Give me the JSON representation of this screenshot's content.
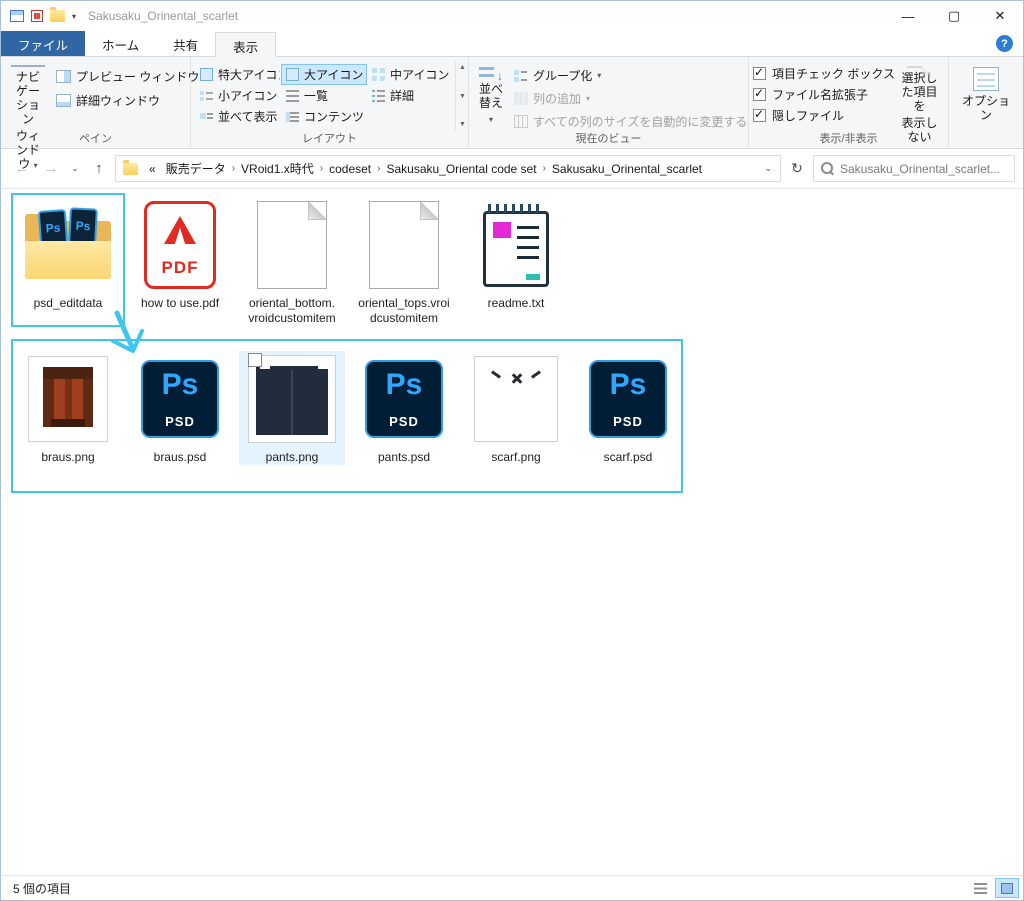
{
  "window": {
    "title": "Sakusaku_Orinental_scarlet",
    "controls": {
      "minimize": "—",
      "maximize": "▢",
      "close": "✕"
    }
  },
  "tabs": {
    "file": "ファイル",
    "home": "ホーム",
    "share": "共有",
    "view": "表示",
    "help": "?"
  },
  "ribbon": {
    "panes": {
      "label": "ペイン",
      "nav_line1": "ナビゲーション",
      "nav_line2": "ウィンドウ",
      "preview": "プレビュー ウィンドウ",
      "details": "詳細ウィンドウ"
    },
    "layout": {
      "label": "レイアウト",
      "items": [
        "特大アイコン",
        "大アイコン",
        "中アイコン",
        "小アイコン",
        "一覧",
        "詳細",
        "並べて表示",
        "コンテンツ"
      ],
      "selected": "大アイコン"
    },
    "current_view": {
      "label": "現在のビュー",
      "sort": "並べ替え",
      "group_by": "グループ化",
      "add_columns": "列の追加",
      "autosize": "すべての列のサイズを自動的に変更する"
    },
    "show_hide": {
      "label": "表示/非表示",
      "item_checkboxes": "項目チェック ボックス",
      "extensions": "ファイル名拡張子",
      "hidden_files": "隠しファイル",
      "hide_selected_line1": "選択した項目を",
      "hide_selected_line2": "表示しない"
    },
    "options": {
      "label": "オプション"
    }
  },
  "icons": {
    "back": "←",
    "forward": "→",
    "up": "↑",
    "dropdown_small": "⌄",
    "refresh": "↻",
    "crumb_sep": "›",
    "overflow": "«",
    "chevron": "▾",
    "scroll_up": "▲",
    "scroll_down": "▼",
    "check": "✓"
  },
  "addressbar": {
    "breadcrumbs": [
      "販売データ",
      "VRoid1.x時代",
      "codeset",
      "Sakusaku_Oriental code set",
      "Sakusaku_Orinental_scarlet"
    ],
    "search_placeholder": "Sakusaku_Orinental_scarlet..."
  },
  "files": {
    "ps": "Ps",
    "psd": "PSD",
    "pdf": "PDF",
    "row1": [
      {
        "line1": "psd_editdata",
        "line2": "",
        "icon": "folder-with-psd"
      },
      {
        "line1": "how to use.pdf",
        "line2": "",
        "icon": "pdf-file"
      },
      {
        "line1": "oriental_bottom.",
        "line2": "vroidcustomitem",
        "icon": "generic-file"
      },
      {
        "line1": "oriental_tops.vroi",
        "line2": "dcustomitem",
        "icon": "generic-file"
      },
      {
        "line1": "readme.txt",
        "line2": "",
        "icon": "notepad-file"
      }
    ],
    "row2": [
      {
        "line1": "braus.png",
        "line2": "",
        "icon": "image-thumbnail"
      },
      {
        "line1": "braus.psd",
        "line2": "",
        "icon": "photoshop-file"
      },
      {
        "line1": "pants.png",
        "line2": "",
        "icon": "image-thumbnail"
      },
      {
        "line1": "pants.psd",
        "line2": "",
        "icon": "photoshop-file"
      },
      {
        "line1": "scarf.png",
        "line2": "",
        "icon": "image-thumbnail"
      },
      {
        "line1": "scarf.psd",
        "line2": "",
        "icon": "photoshop-file"
      }
    ]
  },
  "statusbar": {
    "items_count": "5 個の項目"
  }
}
